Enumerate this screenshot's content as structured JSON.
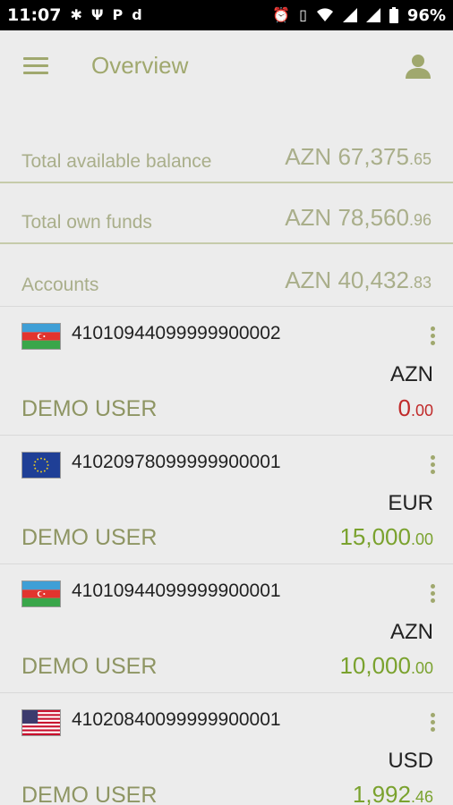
{
  "status_bar": {
    "time": "11:07",
    "battery": "96%",
    "left_icons": [
      "android-icon",
      "usb-icon",
      "parking-icon",
      "app-d-icon"
    ],
    "right_icons": [
      "alarm-icon",
      "vibrate-icon",
      "wifi-icon",
      "signal-icon",
      "signal-icon",
      "battery-icon"
    ]
  },
  "header": {
    "title": "Overview"
  },
  "summary": [
    {
      "label": "Total available balance",
      "currency": "AZN",
      "amount": "67,375",
      "cents": ".65"
    },
    {
      "label": "Total own funds",
      "currency": "AZN",
      "amount": "78,560",
      "cents": ".96"
    },
    {
      "label": "Accounts",
      "currency": "AZN",
      "amount": "40,432",
      "cents": ".83"
    }
  ],
  "accounts": [
    {
      "number": "41010944099999900002",
      "flag": "azerbaijan-flag-icon",
      "currency": "AZN",
      "holder": "DEMO USER",
      "amount": "0",
      "cents": ".00",
      "status_color": "#c02a2a"
    },
    {
      "number": "41020978099999900001",
      "flag": "eu-flag-icon",
      "currency": "EUR",
      "holder": "DEMO USER",
      "amount": "15,000",
      "cents": ".00",
      "status_color": "#7aa22e"
    },
    {
      "number": "41010944099999900001",
      "flag": "azerbaijan-flag-icon",
      "currency": "AZN",
      "holder": "DEMO USER",
      "amount": "10,000",
      "cents": ".00",
      "status_color": "#7aa22e"
    },
    {
      "number": "41020840099999900001",
      "flag": "usa-flag-icon",
      "currency": "USD",
      "holder": "DEMO USER",
      "amount": "1,992",
      "cents": ".46",
      "status_color": "#7aa22e"
    }
  ],
  "colors": {
    "accent": "#a0a86e",
    "background": "#ececec",
    "negative": "#c02a2a",
    "positive": "#7aa22e"
  }
}
